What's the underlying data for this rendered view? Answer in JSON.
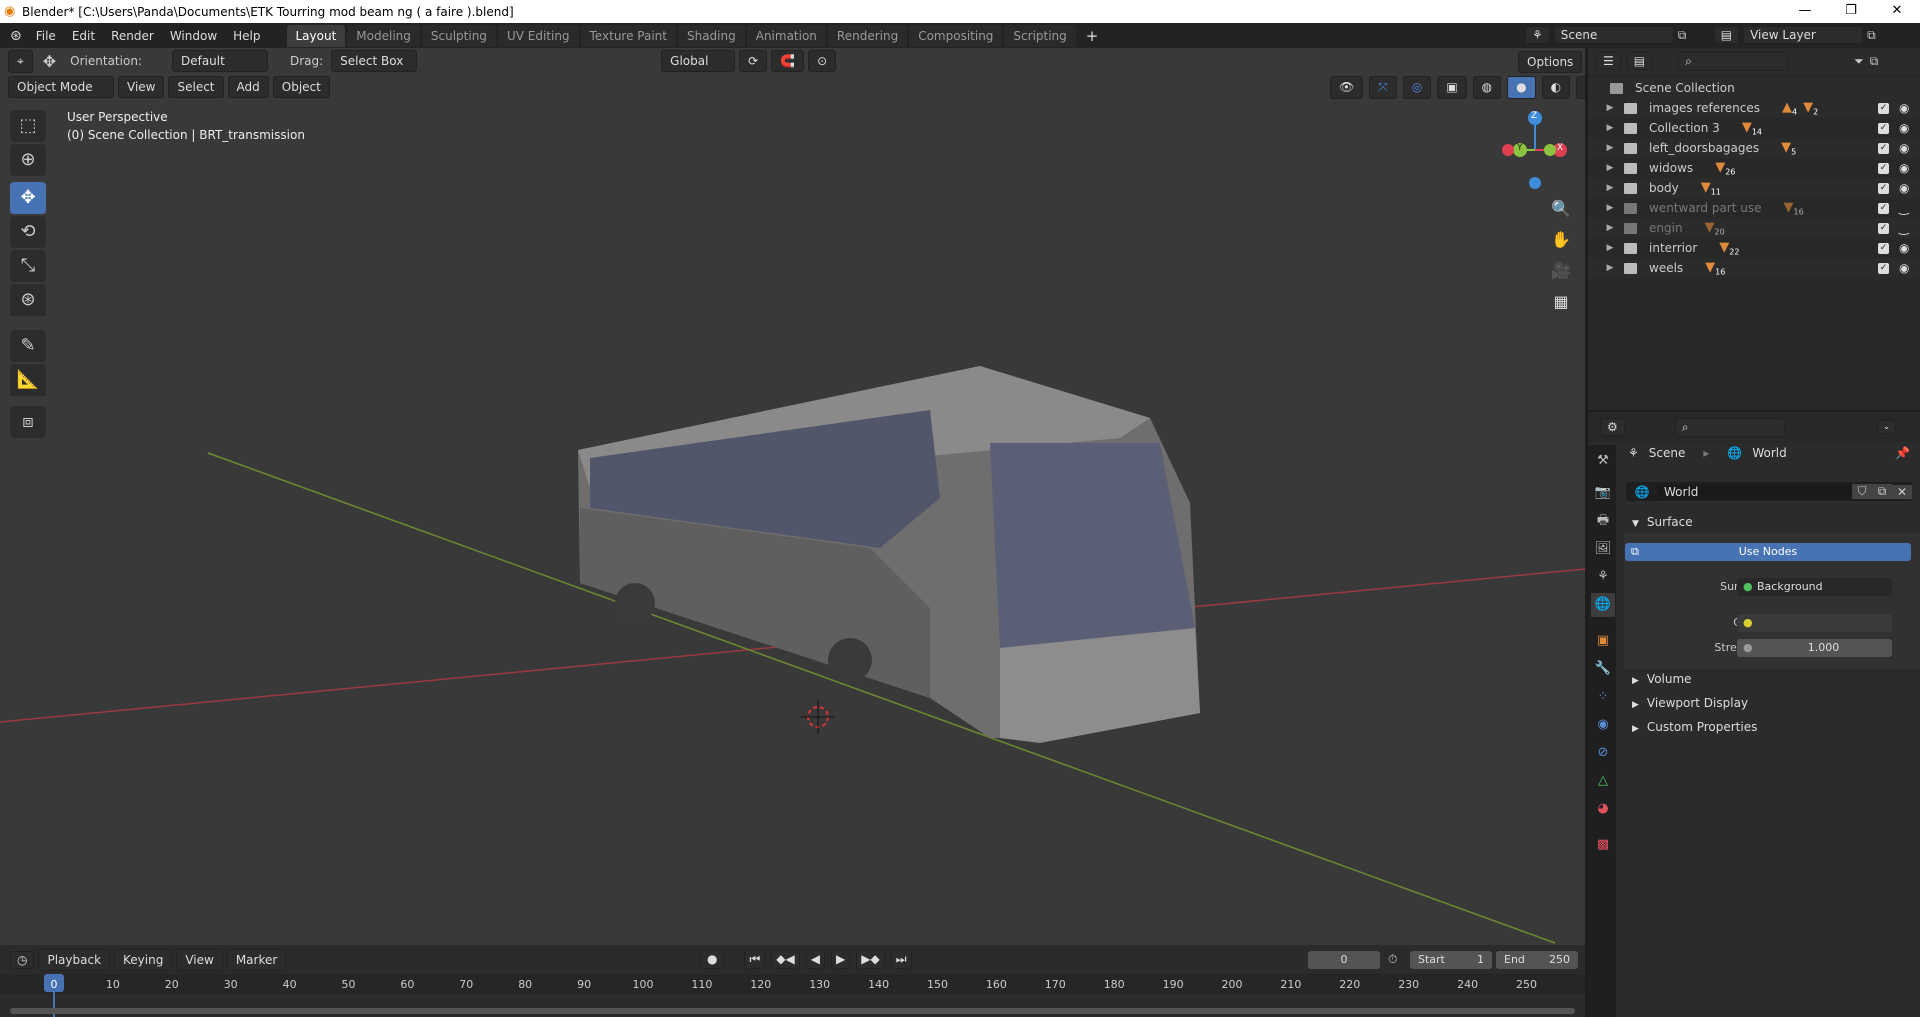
{
  "title": "Blender* [C:\\Users\\Panda\\Documents\\ETK Tourring mod beam ng ( a faire ).blend]",
  "menu": [
    "File",
    "Edit",
    "Render",
    "Window",
    "Help"
  ],
  "workspaces": [
    "Layout",
    "Modeling",
    "Sculpting",
    "UV Editing",
    "Texture Paint",
    "Shading",
    "Animation",
    "Rendering",
    "Compositing",
    "Scripting"
  ],
  "scene": "Scene",
  "view_layer": "View Layer",
  "header": {
    "orientation_label": "Orientation:",
    "orientation": "Default",
    "drag_label": "Drag:",
    "drag": "Select Box",
    "transform": "Global",
    "options": "Options",
    "mode": "Object Mode",
    "view": "View",
    "select": "Select",
    "add": "Add",
    "object": "Object"
  },
  "viewport": {
    "perspective": "User Perspective",
    "context": "(0) Scene Collection | BRT_transmission",
    "axes": {
      "x": "X",
      "y": "Y",
      "z": "Z"
    }
  },
  "outliner": {
    "root": "Scene Collection",
    "items": [
      {
        "name": "images references",
        "count": "2",
        "img_count": "4",
        "visible": true
      },
      {
        "name": "Collection 3",
        "count": "14",
        "visible": true
      },
      {
        "name": "left_doorsbagages",
        "count": "5",
        "visible": true
      },
      {
        "name": "widows",
        "count": "26",
        "visible": true
      },
      {
        "name": "body",
        "count": "11",
        "visible": true
      },
      {
        "name": "wentward part use",
        "count": "16",
        "visible": false
      },
      {
        "name": "engin",
        "count": "20",
        "visible": false
      },
      {
        "name": "interrior",
        "count": "22",
        "visible": true
      },
      {
        "name": "weels",
        "count": "16",
        "visible": true
      }
    ]
  },
  "properties": {
    "breadcrumb_scene": "Scene",
    "breadcrumb_world": "World",
    "world_name": "World",
    "surface_section": "Surface",
    "use_nodes": "Use Nodes",
    "surface_label": "Surface",
    "surface_value": "Background",
    "color_label": "Color",
    "strength_label": "Strength",
    "strength_value": "1.000",
    "sections": [
      "Volume",
      "Viewport Display",
      "Custom Properties"
    ]
  },
  "timeline": {
    "playback": "Playback",
    "keying": "Keying",
    "view": "View",
    "marker": "Marker",
    "current_frame": "0",
    "start_label": "Start",
    "start": "1",
    "end_label": "End",
    "end": "250",
    "ticks": [
      "0",
      "10",
      "20",
      "30",
      "40",
      "50",
      "60",
      "70",
      "80",
      "90",
      "100",
      "110",
      "120",
      "130",
      "140",
      "150",
      "160",
      "170",
      "180",
      "190",
      "200",
      "210",
      "220",
      "230",
      "240",
      "250"
    ]
  },
  "colors": {
    "accent": "#4772b3",
    "x_axis": "#e0404f",
    "y_axis": "#8bc43e",
    "z_axis": "#3f8cdb",
    "collection_badge": "#e08a3c"
  }
}
